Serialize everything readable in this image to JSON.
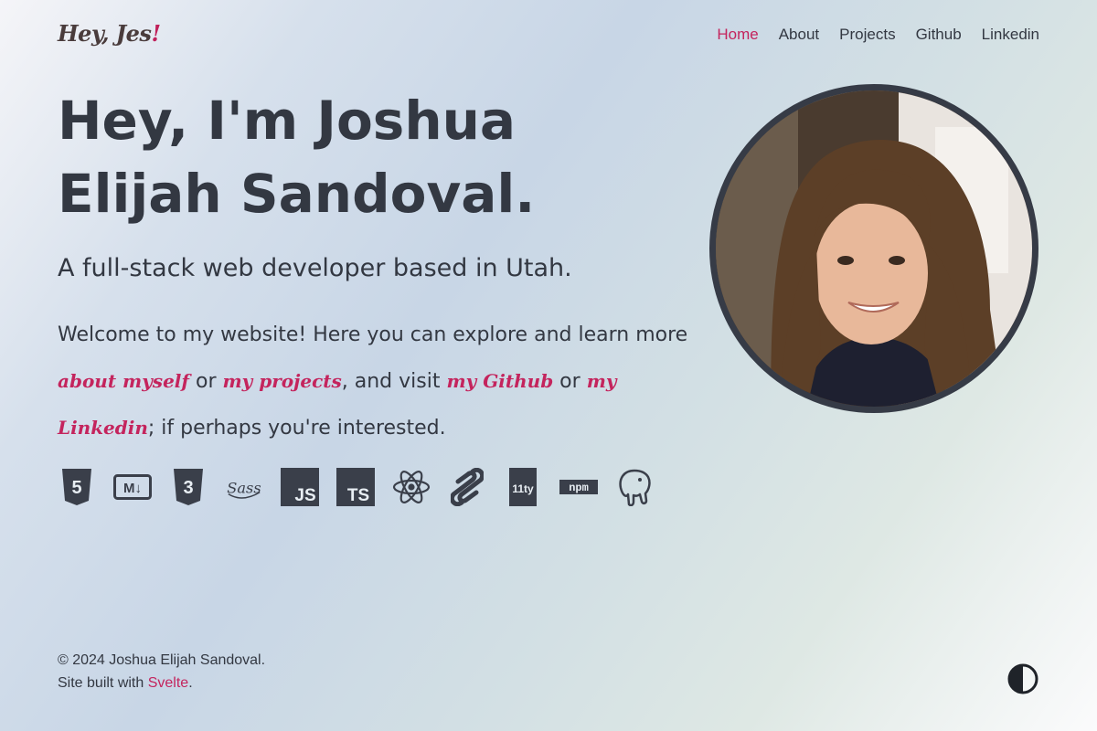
{
  "header": {
    "logo": "Hey, Jes",
    "logo_mark": "!",
    "nav": [
      {
        "label": "Home",
        "active": true
      },
      {
        "label": "About",
        "active": false
      },
      {
        "label": "Projects",
        "active": false
      },
      {
        "label": "Github",
        "active": false
      },
      {
        "label": "Linkedin",
        "active": false
      }
    ]
  },
  "hero": {
    "headline": "Hey, I'm Joshua Elijah Sandoval.",
    "subtitle": "A full-stack web developer based in Utah.",
    "intro": {
      "part1": "Welcome to my website! Here you can explore and learn more ",
      "link_about": "about myself",
      "part2": " or ",
      "link_projects": "my projects",
      "part3": ", and visit ",
      "link_github": "my Github",
      "part4": " or ",
      "link_linkedin": "my Linkedin",
      "part5": "; if perhaps you're interested."
    },
    "tech_icons": [
      "html5-icon",
      "markdown-icon",
      "css3-icon",
      "sass-icon",
      "javascript-icon",
      "typescript-icon",
      "react-icon",
      "svelte-icon",
      "eleventy-icon",
      "npm-icon",
      "postgresql-icon"
    ],
    "tech_labels": {
      "markdown": "M↓",
      "sass": "Sass",
      "javascript": "JS",
      "typescript": "TS",
      "eleventy": "11ty",
      "npm": "npm"
    }
  },
  "footer": {
    "copyright": "© 2024 Joshua Elijah Sandoval.",
    "built_prefix": "Site built with ",
    "built_link": "Svelte",
    "built_suffix": "."
  },
  "colors": {
    "accent": "#c4245d",
    "text": "#333842",
    "icon": "#3a3f4a"
  }
}
